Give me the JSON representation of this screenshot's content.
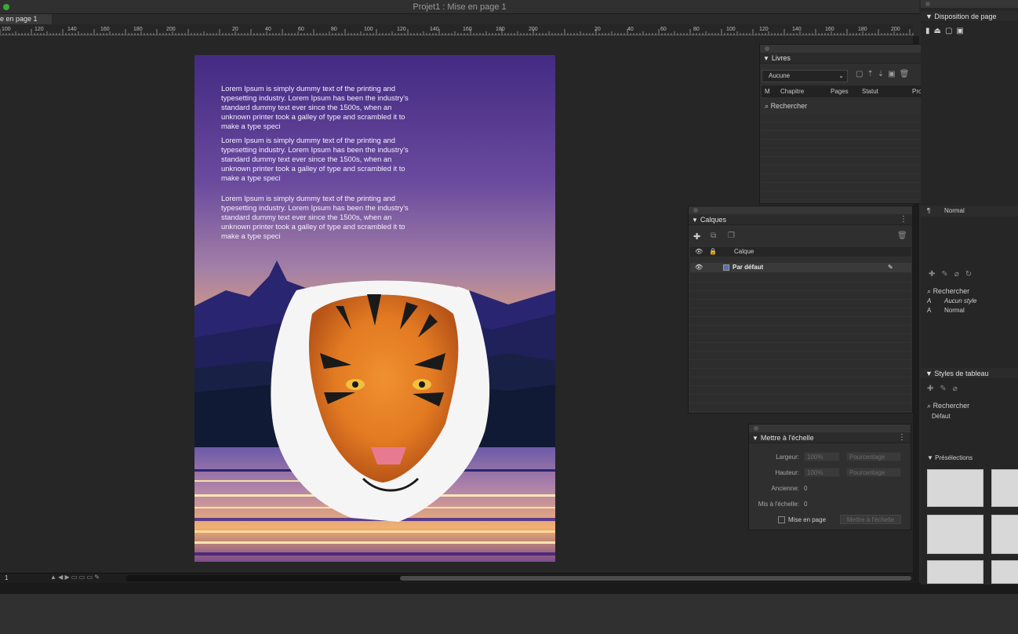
{
  "window": {
    "title": "Projet1 : Mise en page 1",
    "tab": "e en page 1"
  },
  "ruler": {
    "labels": [
      "100",
      "120",
      "140",
      "160",
      "180",
      "200",
      "",
      "20",
      "40",
      "60",
      "80",
      "100",
      "120",
      "140",
      "160",
      "180",
      "200",
      "",
      "20",
      "40",
      "60",
      "80",
      "100",
      "120",
      "140",
      "160",
      "180",
      "200"
    ]
  },
  "document": {
    "paragraphs": [
      "Lorem Ipsum is simply dummy text of the printing and typesetting industry. Lorem Ipsum has been the industry's standard dummy text ever since the 1500s, when an unknown printer took a galley of type and scrambled it to make a type speci",
      "Lorem Ipsum is simply dummy text of the printing and typesetting industry. Lorem Ipsum has been the industry's standard dummy text ever since the 1500s, when an unknown printer took a galley of type and scrambled it to make a type speci",
      "Lorem Ipsum is simply dummy text of the printing and typesetting industry. Lorem Ipsum has been the industry's standard dummy text ever since the 1500s, when an unknown printer took a galley of type and scrambled it to make a type speci"
    ]
  },
  "status": {
    "page": "1"
  },
  "livres": {
    "title": "Livres",
    "select": "Aucune",
    "columns": [
      "M",
      "Chapitre",
      "Pages",
      "Statut",
      "Projet"
    ],
    "search": "Rechercher"
  },
  "calques": {
    "title": "Calques",
    "header_label": "Calque",
    "layer": "Par défaut",
    "layer_color": "#5a6ab8"
  },
  "echelle": {
    "title": "Mettre à l'échelle",
    "largeur_label": "Largeur:",
    "largeur_value": "100%",
    "largeur_unit": "Pourcentage",
    "hauteur_label": "Hauteur:",
    "hauteur_value": "100%",
    "hauteur_unit": "Pourcentage",
    "ancienne_label": "Ancienne:",
    "ancienne_value": "0",
    "mis_label": "Mis à l'échelle:",
    "mis_value": "0",
    "checkbox_label": "Mise en page",
    "button": "Mettre à l'échelle"
  },
  "right": {
    "disposition_title": "Disposition de page",
    "para_style": "Normal",
    "search": "Rechercher",
    "style_none": "Aucun style",
    "style_normal": "Normal",
    "tableau_title": "Styles de tableau",
    "tableau_search": "Rechercher",
    "tableau_default": "Défaut",
    "presel_title": "Présélections"
  },
  "colors": {
    "accent": "#3aa83a",
    "panel": "#2f2f2f",
    "canvas": "#262626"
  }
}
